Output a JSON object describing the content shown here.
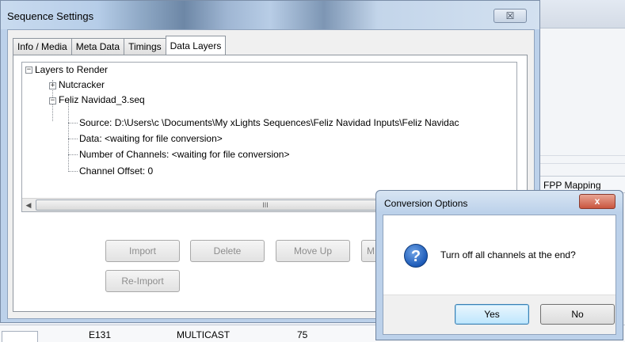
{
  "background": {
    "header_label": "FPP Mapping",
    "row": {
      "col1": "E131",
      "col2": "MULTICAST",
      "col3": "75"
    }
  },
  "dialog": {
    "title": "Sequence Settings",
    "close_glyph": "☒",
    "tabs": [
      {
        "label": "Info / Media"
      },
      {
        "label": "Meta Data"
      },
      {
        "label": "Timings"
      },
      {
        "label": "Data Layers"
      }
    ],
    "active_tab": "Data Layers",
    "tree": {
      "root": "Layers to Render",
      "nutcracker": "Nutcracker",
      "file": "Feliz Navidad_3.seq",
      "source": "Source: D:\\Users\\c           \\Documents\\My xLights Sequences\\Feliz Navidad Inputs\\Feliz Navidac",
      "data": "Data: <waiting for file conversion>",
      "channels": "Number of Channels: <waiting for file conversion>",
      "offset": "Channel Offset: 0"
    },
    "scroll_thumb": "III",
    "buttons": {
      "import": "Import",
      "delete": "Delete",
      "move_up": "Move Up",
      "move_down": "M",
      "reimport": "Re-Import"
    }
  },
  "conversion_dialog": {
    "title": "Conversion Options",
    "close_glyph": "x",
    "message": "Turn off all channels at the end?",
    "yes": "Yes",
    "no": "No"
  }
}
